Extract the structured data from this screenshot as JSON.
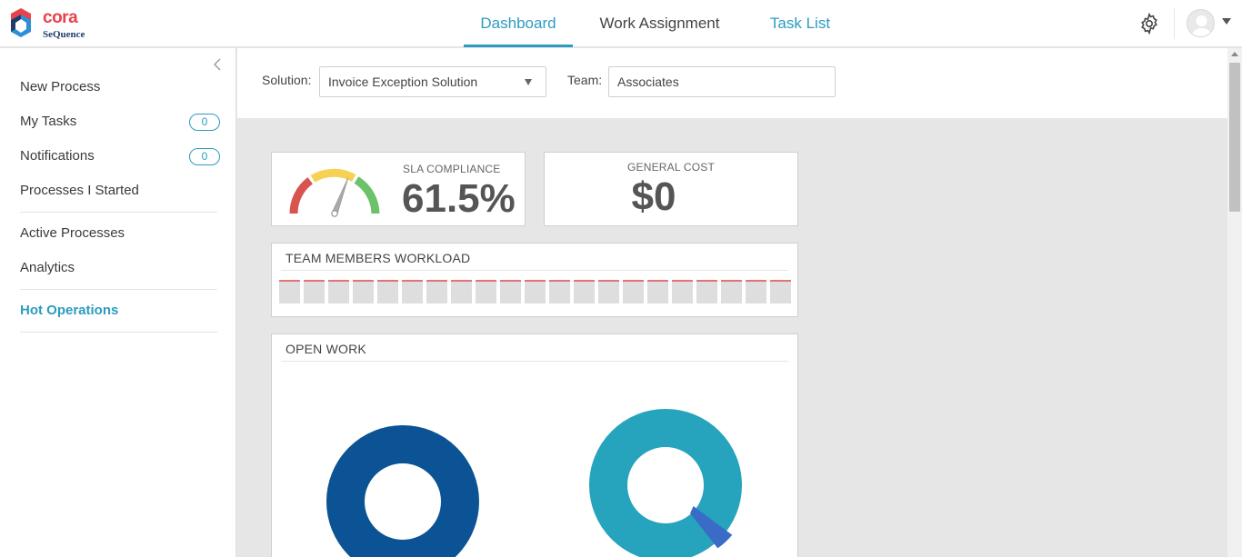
{
  "header": {
    "logo": {
      "brand": "cora",
      "product": "SeQuence"
    },
    "tabs": [
      {
        "label": "Dashboard",
        "active": true
      },
      {
        "label": "Work Assignment",
        "active": false
      },
      {
        "label": "Task List",
        "active": false
      }
    ],
    "icons": {
      "settings": "gear-icon",
      "user": "avatar-icon"
    }
  },
  "sidebar": {
    "items": [
      {
        "label": "New Process"
      },
      {
        "label": "My Tasks",
        "badge": "0"
      },
      {
        "label": "Notifications",
        "badge": "0"
      },
      {
        "label": "Processes I Started"
      },
      {
        "label": "Active Processes"
      },
      {
        "label": "Analytics"
      },
      {
        "label": "Hot Operations",
        "active": true
      }
    ]
  },
  "filters": {
    "solution_label": "Solution:",
    "solution_value": "Invoice Exception Solution",
    "team_label": "Team:",
    "team_value": "Associates"
  },
  "kpis": {
    "sla": {
      "label": "SLA COMPLIANCE",
      "value": "61.5%",
      "gauge_fraction": 0.615
    },
    "cost": {
      "label": "GENERAL COST",
      "value": "$0"
    }
  },
  "workload": {
    "title": "TEAM MEMBERS WORKLOAD",
    "member_count": 21
  },
  "open_work": {
    "title": "OPEN WORK"
  },
  "colors": {
    "accent": "#2b9cc0",
    "brand_red": "#e8424d",
    "brand_navy": "#1f3c6d",
    "donut_left": "#0b5394",
    "donut_right_main": "#26a3bd",
    "donut_right_slice": "#3a6cc7",
    "gauge_red": "#d9534f",
    "gauge_yellow": "#f7d154",
    "gauge_green": "#6cc26a",
    "workload_line": "#e57373"
  }
}
